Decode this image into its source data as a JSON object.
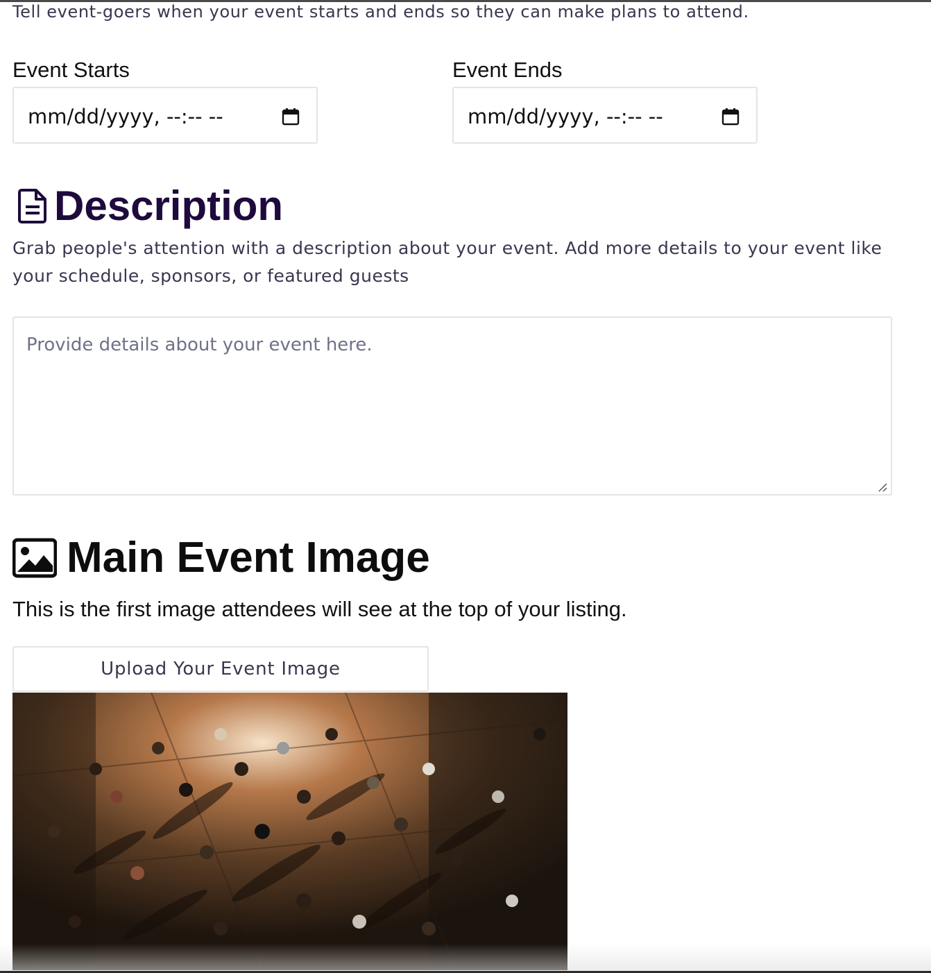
{
  "intro": {
    "text": "Tell event-goers when your event starts and ends so they can make plans to attend."
  },
  "event_starts": {
    "label": "Event Starts",
    "value": "mm/dd/yyyy, --:-- --",
    "icon": "calendar-icon"
  },
  "event_ends": {
    "label": "Event Ends",
    "value": "mm/dd/yyyy, --:-- --",
    "icon": "calendar-icon"
  },
  "description": {
    "title": "Description",
    "icon": "document-icon",
    "help": "Grab people's attention with a description about your event. Add more details to your event like your schedule, sponsors, or featured guests",
    "placeholder": "Provide details about your event here.",
    "heading_color": "#1e0a3c"
  },
  "main_image": {
    "title": "Main Event Image",
    "icon": "image-icon",
    "subtitle": "This is the first image attendees will see at the top of your listing.",
    "upload_label": "Upload Your Event Image",
    "photo": "crowd-dancing-photo"
  }
}
